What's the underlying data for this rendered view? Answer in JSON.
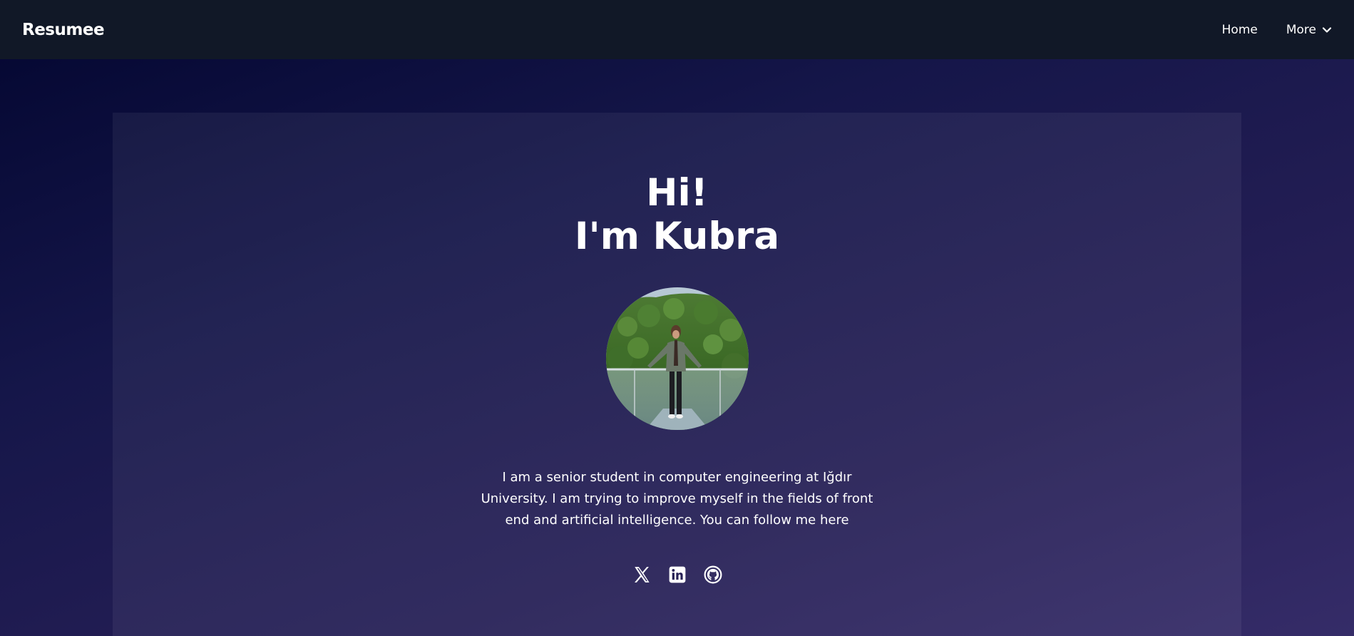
{
  "navbar": {
    "brand": "Resumee",
    "links": [
      {
        "label": "Home"
      },
      {
        "label": "More",
        "icon": "chevron-down-icon"
      }
    ]
  },
  "hero": {
    "greeting": "Hi!",
    "name_line": "I'm Kubra",
    "avatar_icon": "profile-photo",
    "bio": "I am a senior student in computer engineering at Iğdır University. I am trying to improve myself in the fields of front end and artificial intelligence. You can follow me here"
  },
  "socials": [
    {
      "icon": "x-twitter-icon"
    },
    {
      "icon": "linkedin-icon"
    },
    {
      "icon": "github-icon"
    }
  ],
  "colors": {
    "navbar_bg": "#111827",
    "text": "#ffffff",
    "bg_start": "#030630",
    "bg_end": "#352c68"
  }
}
